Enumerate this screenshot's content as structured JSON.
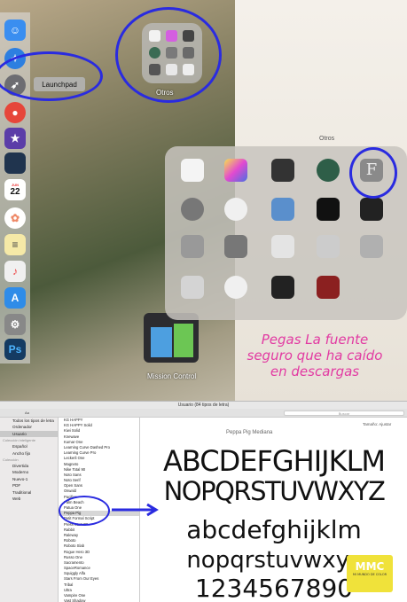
{
  "desktop": {
    "launchpad_tooltip": "Launchpad",
    "otros_label": "Otros",
    "folder_title": "Otros",
    "mission_label": "Mission Control",
    "calendar": {
      "month": "JUN",
      "day": "22"
    }
  },
  "annotation": {
    "note": "Pegas La fuente seguro que ha caído en descargas",
    "color": "#e23aa2",
    "circle_color": "#2a2be0"
  },
  "fontbook": {
    "window_title": "Usuario (84 tipos de letra)",
    "search_placeholder": "Buscar",
    "size_label": "Tamaño:",
    "size_value": "Ajustar",
    "sidebar": {
      "items_top": [
        "Todos los tipos de letra",
        "Ordenador",
        "Usuario"
      ],
      "header_smart": "Colección inteligente",
      "items_smart": [
        "Español",
        "Ancho fijo"
      ],
      "header_collection": "Colección",
      "items_collection": [
        "Divertida",
        "Moderno",
        "Nuevo-1",
        "PDF",
        "Traditional",
        "Web"
      ]
    },
    "font_list": [
      "KG HAPPY",
      "KG HAPPY Solid",
      "Kiwi Solid",
      "Knewave",
      "Kumar One",
      "Learning Curve Dashed Pro",
      "Learning Curve Pro",
      "Leckerli One",
      "Magneto",
      "Nike Total 90",
      "Noto Sans",
      "Noto Serif",
      "Open Sans",
      "Oswald",
      "Pacifico",
      "Palm Beach",
      "Patua One",
      "Peppa Pig",
      "Petit Formal Script",
      "Press Start 2P",
      "Rabbit",
      "Raleway",
      "Roboto",
      "Roboto Slab",
      "Rogue Hero 3D",
      "Russo One",
      "Sacramento",
      "SpaceRomance",
      "Squiggly Alfa",
      "Stars From Our Eyes",
      "Tribal",
      "Ultra",
      "Vampire One",
      "Vast Shadow",
      "Yellowtail"
    ],
    "preview": {
      "font_name": "Peppa Pig Mediana",
      "line1": "ABCDEFGHIJKLM",
      "line2": "NOPQRSTUVWXYZ",
      "line3": "abcdefghijklm",
      "line4": "nopqrstuvwxyz",
      "line5": "1234567890"
    }
  },
  "watermark": {
    "big": "MMC",
    "small": "MI MUNDO DE COLOR"
  }
}
